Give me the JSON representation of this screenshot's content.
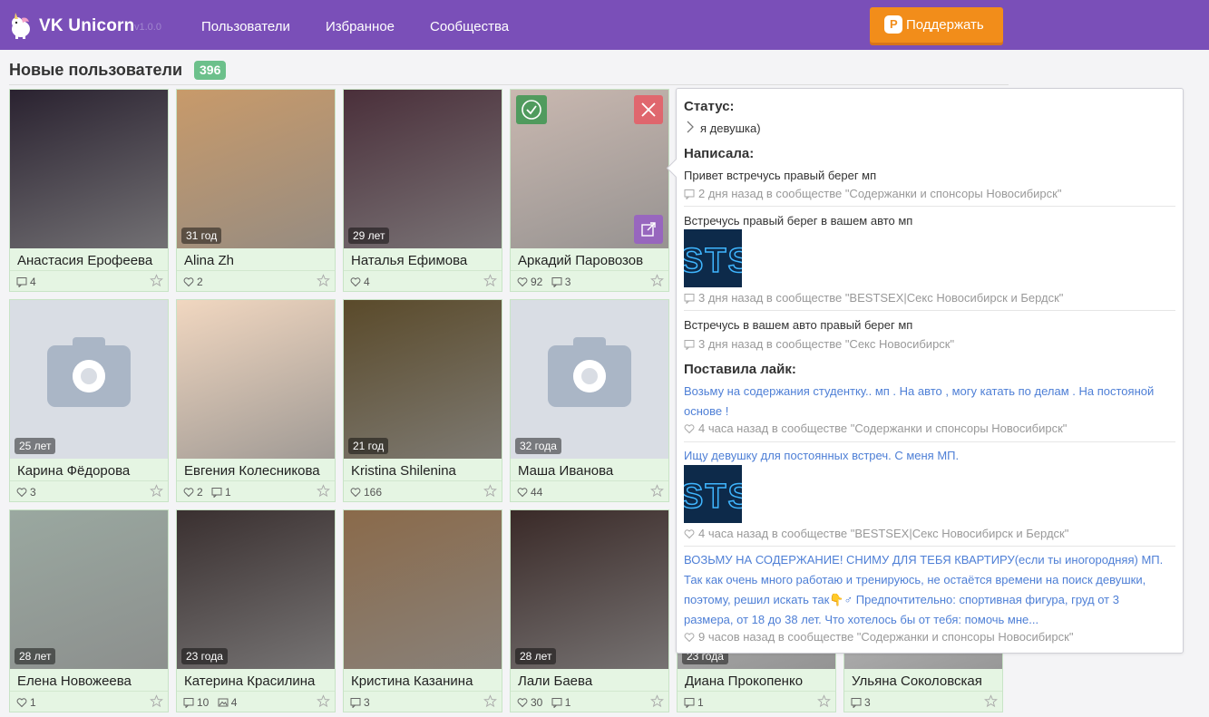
{
  "header": {
    "brand": "VK Unicorn",
    "version": "v1.0.0",
    "nav": [
      "Пользователи",
      "Избранное",
      "Сообщества"
    ],
    "donate_label": "Поддержать"
  },
  "page": {
    "title": "Новые пользователи",
    "count": "396"
  },
  "cards": [
    {
      "name": "Анастасия Ерофеева",
      "age": "",
      "likes": "",
      "comments": "4",
      "photos": "",
      "bg": "#2a2230"
    },
    {
      "name": "Alina Zh",
      "age": "31 год",
      "likes": "2",
      "comments": "",
      "photos": "",
      "bg": "#c89a6a"
    },
    {
      "name": "Наталья Ефимова",
      "age": "29 лет",
      "likes": "4",
      "comments": "",
      "photos": "",
      "bg": "#4a2f3a"
    },
    {
      "name": "Аркадий Паровозов",
      "age": "",
      "likes": "92",
      "comments": "3",
      "photos": "",
      "bg": "#c9b8b0"
    },
    {
      "name": "Карина Фёдорова",
      "age": "25 лет",
      "likes": "3",
      "comments": "",
      "photos": "",
      "bg": ""
    },
    {
      "name": "Евгения Колесникова",
      "age": "",
      "likes": "2",
      "comments": "1",
      "photos": "",
      "bg": "#f1d7c0"
    },
    {
      "name": "Kristina Shilenina",
      "age": "21 год",
      "likes": "166",
      "comments": "",
      "photos": "",
      "bg": "#5a4a2a"
    },
    {
      "name": "Маша Иванова",
      "age": "32 года",
      "likes": "44",
      "comments": "",
      "photos": "",
      "bg": ""
    },
    {
      "name": "Елена Новожеева",
      "age": "28 лет",
      "likes": "1",
      "comments": "",
      "photos": "",
      "bg": "#9aa8a0"
    },
    {
      "name": "Катерина Красилина",
      "age": "23 года",
      "likes": "",
      "comments": "10",
      "photos": "4",
      "bg": "#3a3030"
    },
    {
      "name": "Кристина Казанина",
      "age": "",
      "likes": "",
      "comments": "3",
      "photos": "",
      "bg": "#8a6a4a"
    },
    {
      "name": "Лали Баева",
      "age": "28 лет",
      "likes": "30",
      "comments": "1",
      "photos": "",
      "bg": "#3a2a28"
    },
    {
      "name": "Диана Прокопенко",
      "age": "23 года",
      "likes": "",
      "comments": "1",
      "photos": "",
      "bg": "#bbb"
    },
    {
      "name": "Ульяна Соколовская",
      "age": "",
      "likes": "",
      "comments": "3",
      "photos": "",
      "bg": "#ccc"
    }
  ],
  "panel": {
    "status_heading": "Статус:",
    "status_text": "я девушка)",
    "wrote_heading": "Написала:",
    "posts": [
      {
        "text": "Привет встречусь правый берег мп",
        "meta": "2 дня назад в сообществе \"Содержанки и спонсоры Новосибирск\""
      },
      {
        "text": "Встречусь правый берег в вашем авто мп",
        "meta": "3 дня назад в сообществе \"BESTSEX|Секс Новосибирск и Бердск\""
      },
      {
        "text": "Встречусь в вашем авто правый берег мп",
        "meta": "3 дня назад в сообществе \"Секс Новосибирск\""
      }
    ],
    "liked_heading": "Поставила лайк:",
    "likes": [
      {
        "text": "Возьму на содержания студентку.. мп . На авто , могу катать по делам . На постояной основе !",
        "meta": "4 часа назад в сообществе \"Содержанки и спонсоры Новосибирск\""
      },
      {
        "text": "Ищу девушку для постоянных встреч. С меня МП.",
        "meta": "4 часа назад в сообществе \"BESTSEX|Секс Новосибирск и Бердск\""
      },
      {
        "text": "ВОЗЬМУ НА СОДЕРЖАНИЕ! СНИМУ ДЛЯ ТЕБЯ КВАРТИРУ(если ты иногородняя) МП. Так как очень много работаю и тренируюсь, не остаётся времени на поиск девушки, поэтому, решил искать так👇♂ Предпочтительно: спортивная фигура, груд от 3 размера, от 18 до 38 лет. Что хотелось бы от тебя: помочь мне...",
        "meta": "9 часов назад в сообществе \"Содержанки и спонсоры Новосибирск\""
      }
    ]
  }
}
